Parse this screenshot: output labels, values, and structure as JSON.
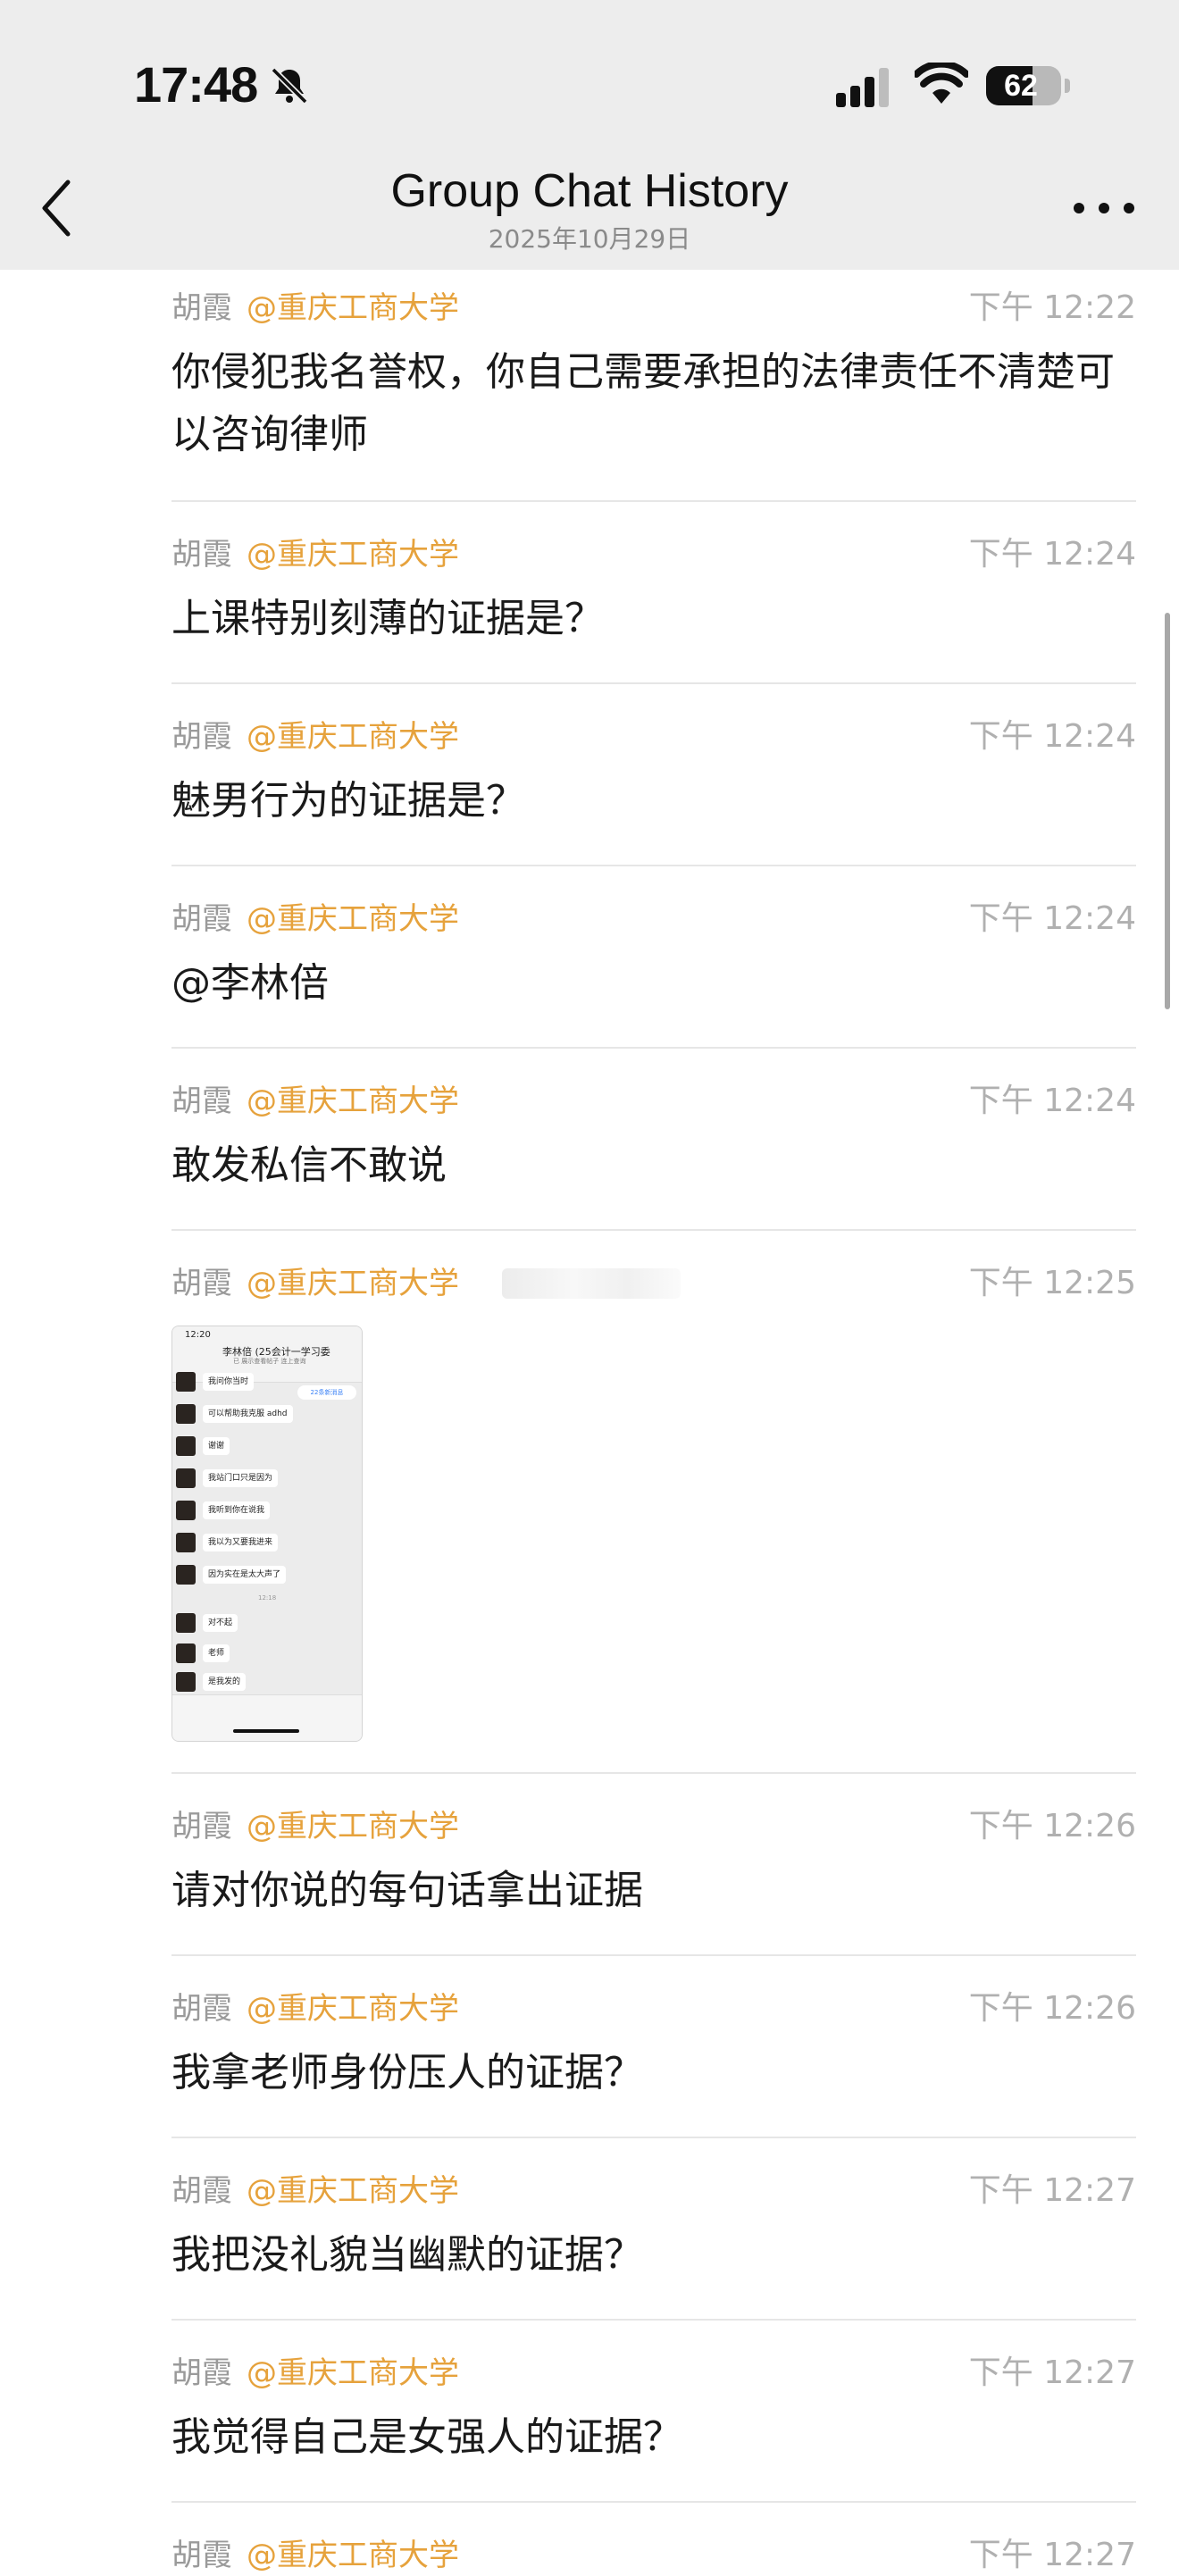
{
  "status_bar": {
    "time": "17:48",
    "battery": "62",
    "battery_level": 0.62
  },
  "header": {
    "title": "Group Chat History",
    "subtitle": "2025年10月29日"
  },
  "icons": {
    "back": "chevron-left-icon",
    "more": "more-dots-icon",
    "bell": "bell-slash-icon"
  },
  "colors": {
    "org": "#e6a23c",
    "sender": "#9a9a9a",
    "time": "#b0b0b0",
    "header_bg": "#ededed"
  },
  "messages": [
    {
      "sender": "胡霞",
      "org": "@重庆工商大学",
      "time": "下午 12:22",
      "text": "你侵犯我名誉权，你自己需要承担的法律责任不清楚可以咨询律师"
    },
    {
      "sender": "胡霞",
      "org": "@重庆工商大学",
      "time": "下午 12:24",
      "text": "上课特别刻薄的证据是？"
    },
    {
      "sender": "胡霞",
      "org": "@重庆工商大学",
      "time": "下午 12:24",
      "text": "魅男行为的证据是？"
    },
    {
      "sender": "胡霞",
      "org": "@重庆工商大学",
      "time": "下午 12:24",
      "text": "@李林倍"
    },
    {
      "sender": "胡霞",
      "org": "@重庆工商大学",
      "time": "下午 12:24",
      "text": "敢发私信不敢说"
    },
    {
      "sender": "胡霞",
      "org": "@重庆工商大学",
      "time": "下午 12:25",
      "text": ""
    },
    {
      "sender": "胡霞",
      "org": "@重庆工商大学",
      "time": "下午 12:26",
      "text": "请对你说的每句话拿出证据"
    },
    {
      "sender": "胡霞",
      "org": "@重庆工商大学",
      "time": "下午 12:26",
      "text": "我拿老师身份压人的证据？"
    },
    {
      "sender": "胡霞",
      "org": "@重庆工商大学",
      "time": "下午 12:27",
      "text": "我把没礼貌当幽默的证据？"
    },
    {
      "sender": "胡霞",
      "org": "@重庆工商大学",
      "time": "下午 12:27",
      "text": "我觉得自己是女强人的证据？"
    },
    {
      "sender": "胡霞",
      "org": "@重庆工商大学",
      "time": "下午 12:27",
      "text": ""
    }
  ],
  "screenshot": {
    "clock": "12:20",
    "title": "李林倍 (25会计一学习委",
    "subtitle": "已 展示查看帖子 连上查询",
    "badge": "22条新消息",
    "time_divider": "12:18",
    "bubbles": [
      "我问你当时",
      "可以帮助我克服 adhd",
      "谢谢",
      "我站门口只是因为",
      "我听到你在说我",
      "我以为又要我进来",
      "因为实在是太大声了",
      "对不起",
      "老师",
      "是我发的"
    ]
  }
}
